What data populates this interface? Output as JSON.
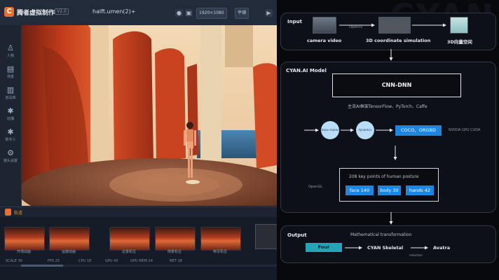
{
  "app": {
    "title": "腾者虚拟制作",
    "version": "V2.0",
    "document": "halft.umen(2)+",
    "toolbar_select_1": "1920×1080",
    "toolbar_select_2": "平铺"
  },
  "sidebar": {
    "items": [
      {
        "label": "人物",
        "icon": "person-icon"
      },
      {
        "label": "场景",
        "icon": "scene-icon"
      },
      {
        "label": "道具库",
        "icon": "props-icon"
      },
      {
        "label": "动捕",
        "icon": "mocap-icon"
      },
      {
        "label": "数字人",
        "icon": "digital-human-icon"
      },
      {
        "label": "镜头设置",
        "icon": "camera-settings-icon"
      }
    ]
  },
  "timeline": {
    "label": "轨道",
    "clips": [
      {
        "label": "开场动画"
      },
      {
        "label": "运镜动画"
      },
      {
        "label": "近景机位"
      },
      {
        "label": "侧景机位"
      },
      {
        "label": "特写机位"
      }
    ],
    "status": [
      {
        "label": "SCALE",
        "value": "36"
      },
      {
        "label": "FPS",
        "value": "25"
      },
      {
        "label": "CPU",
        "value": "18"
      },
      {
        "label": "GPU",
        "value": "43"
      },
      {
        "label": "GPU MEM",
        "value": "24"
      },
      {
        "label": "NET",
        "value": "28"
      }
    ]
  },
  "diagram": {
    "watermark": "CYAN",
    "input": {
      "title": "Input",
      "camera_video": "camera video",
      "opencv": "Opencv",
      "coord_sim": "3D coordinate simulation",
      "vector_space": "3D向量空间"
    },
    "model": {
      "title": "CYAN.AI Model",
      "cnn": "CNN-DNN",
      "frameworks": "主流AI框架TensorFlow、PyTorch、Caffe",
      "circle1": "bone chains",
      "circle2": "dynamics",
      "datasets": "COCO、ORGBD",
      "gpu": "NVIDIA GPU CUDA",
      "opengl": "OpenGL",
      "keypoints_title": "208 key points of human posture",
      "face": "face 140",
      "body": "body 30",
      "hands": "hands 42"
    },
    "output": {
      "title": "Output",
      "math": "Mathematical transformation",
      "four": "Four elements",
      "skeletal": "CYAN Skeletal",
      "avatar": "Avatra",
      "arrow_note": "reduction"
    }
  },
  "colors": {
    "accent_orange": "#e8702a",
    "diagram_blue": "#1d86e1",
    "circle_blue": "#b9dcf7",
    "teal": "#25a4b8"
  }
}
